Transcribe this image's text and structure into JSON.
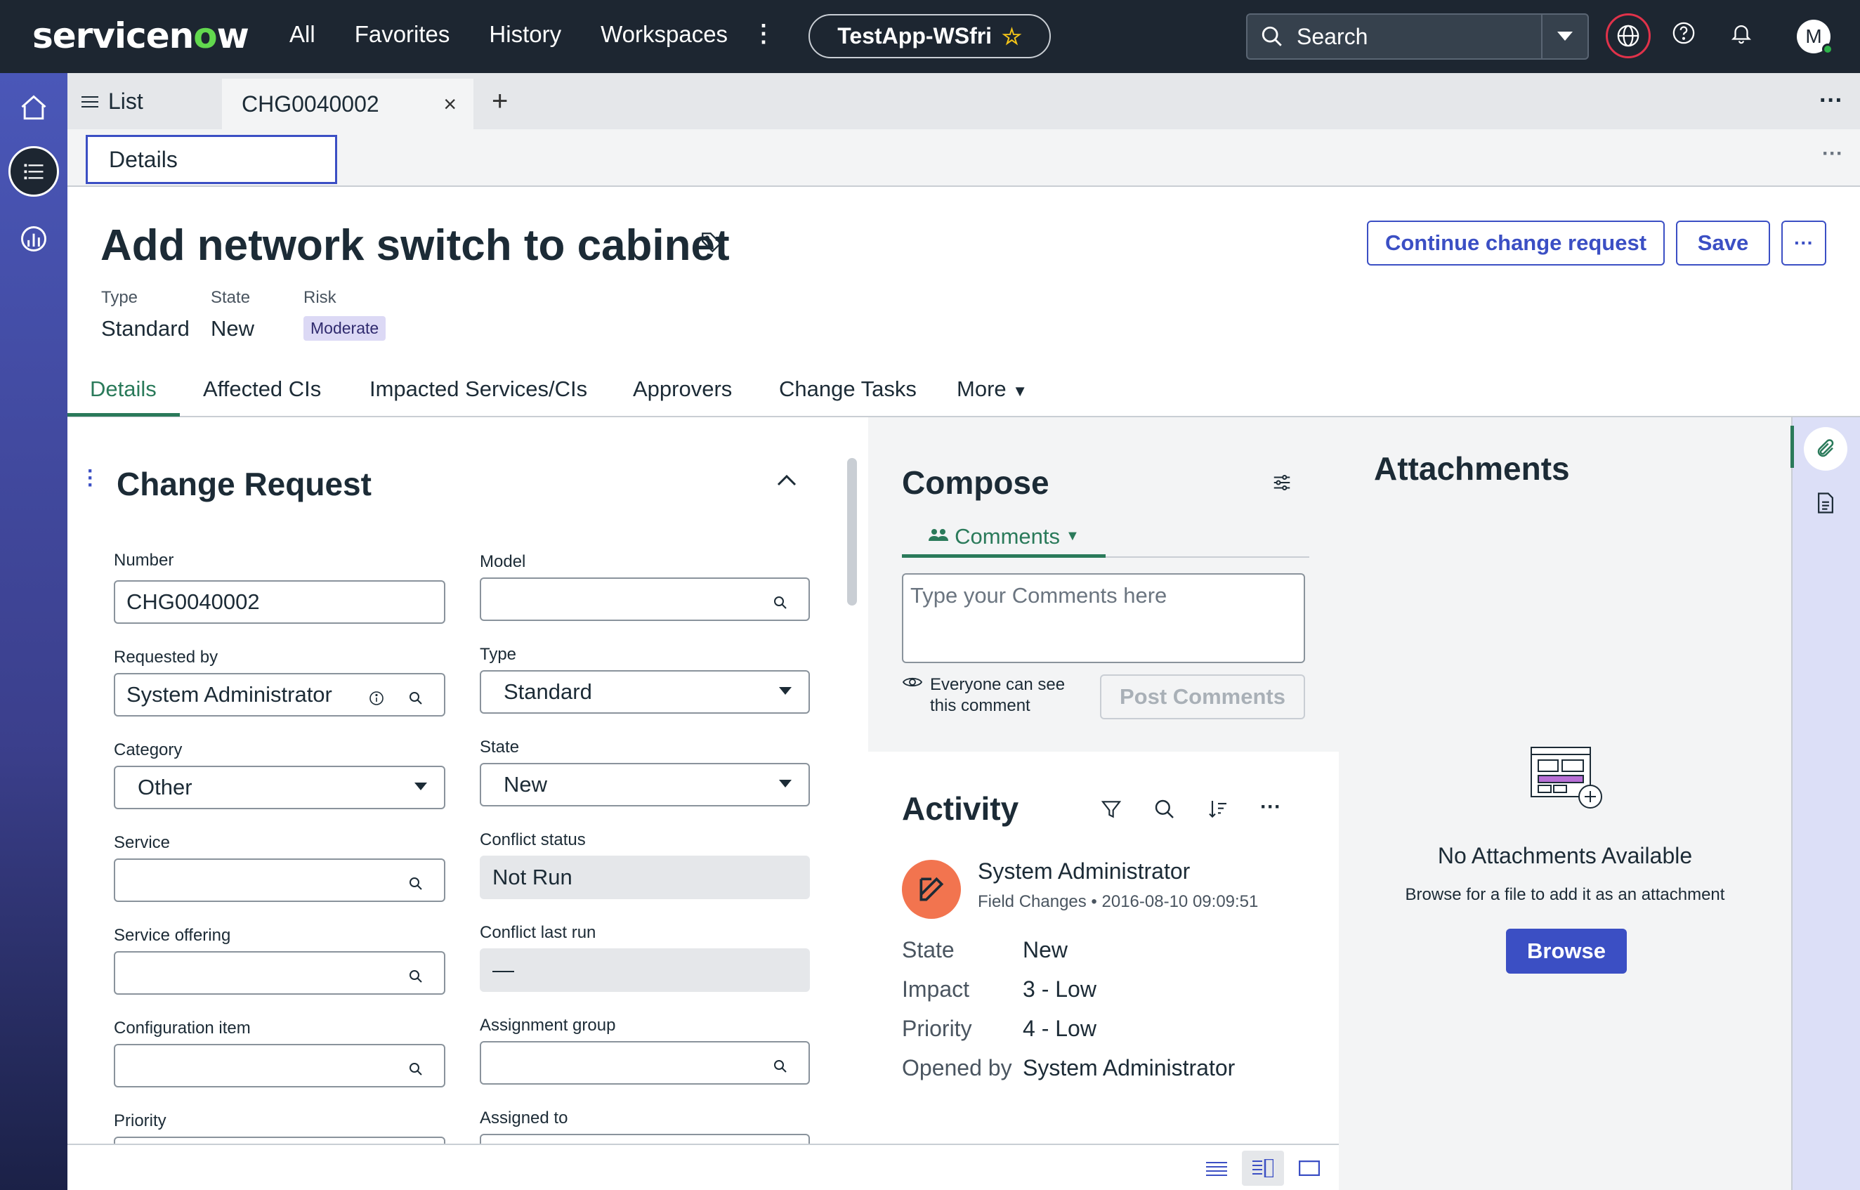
{
  "topbar": {
    "logo_pre": "servicen",
    "logo_o": "o",
    "logo_post": "w",
    "nav": [
      "All",
      "Favorites",
      "History",
      "Workspaces"
    ],
    "app_name": "TestApp-WSfri",
    "search_placeholder": "Search",
    "avatar_initial": "M"
  },
  "tabs": {
    "list_label": "List",
    "active_label": "CHG0040002"
  },
  "subtab": {
    "details_label": "Details"
  },
  "record": {
    "title": "Add network switch to cabinet",
    "meta": [
      {
        "label": "Type",
        "value": "Standard"
      },
      {
        "label": "State",
        "value": "New"
      },
      {
        "label": "Risk",
        "value": "Moderate"
      }
    ],
    "continue_label": "Continue change request",
    "save_label": "Save",
    "tabs": [
      "Details",
      "Affected CIs",
      "Impacted Services/CIs",
      "Approvers",
      "Change Tasks",
      "More"
    ]
  },
  "form": {
    "section_title": "Change Request",
    "fields": {
      "number": {
        "label": "Number",
        "value": "CHG0040002"
      },
      "model": {
        "label": "Model",
        "value": ""
      },
      "requested_by": {
        "label": "Requested by",
        "value": "System Administrator"
      },
      "type": {
        "label": "Type",
        "value": "Standard"
      },
      "category": {
        "label": "Category",
        "value": "Other"
      },
      "state": {
        "label": "State",
        "value": "New"
      },
      "service": {
        "label": "Service",
        "value": ""
      },
      "conflict_status": {
        "label": "Conflict status",
        "value": "Not Run"
      },
      "service_offering": {
        "label": "Service offering",
        "value": ""
      },
      "conflict_last_run": {
        "label": "Conflict last run",
        "value": "—"
      },
      "configuration_item": {
        "label": "Configuration item",
        "value": ""
      },
      "assignment_group": {
        "label": "Assignment group",
        "value": ""
      },
      "priority": {
        "label": "Priority"
      },
      "assigned_to": {
        "label": "Assigned to"
      }
    }
  },
  "compose": {
    "title": "Compose",
    "tab_label": "Comments",
    "placeholder": "Type your Comments here",
    "visibility_text": "Everyone can see this comment",
    "post_label": "Post Comments"
  },
  "activity": {
    "title": "Activity",
    "author": "System Administrator",
    "entry_type": "Field Changes",
    "timestamp": "2016-08-10 09:09:51",
    "changes": [
      {
        "field": "State",
        "value": "New"
      },
      {
        "field": "Impact",
        "value": "3 - Low"
      },
      {
        "field": "Priority",
        "value": "4 - Low"
      },
      {
        "field": "Opened by",
        "value": "System Administrator"
      }
    ]
  },
  "attachments": {
    "title": "Attachments",
    "empty_title": "No Attachments Available",
    "empty_sub": "Browse for a file to add it as an attachment",
    "browse_label": "Browse"
  },
  "colors": {
    "navbar": "#1d2631",
    "accent": "#3b4fc4",
    "active_tab": "#2a7a5a",
    "rail_top": "#4a57b8"
  }
}
